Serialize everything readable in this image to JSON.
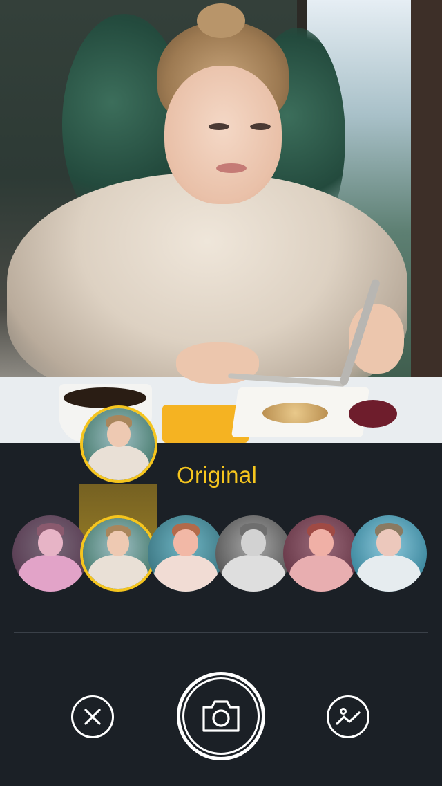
{
  "preview": {
    "description_icon": "photo-preview"
  },
  "filter": {
    "current_name": "Original",
    "accent_color": "#f5c51e",
    "thumbnails": [
      {
        "icon": "filter-thumb",
        "tint": "magenta"
      },
      {
        "icon": "filter-thumb",
        "tint": "original",
        "selected": true
      },
      {
        "icon": "filter-thumb",
        "tint": "warm"
      },
      {
        "icon": "filter-thumb",
        "tint": "mono"
      },
      {
        "icon": "filter-thumb",
        "tint": "red"
      },
      {
        "icon": "filter-thumb",
        "tint": "cool"
      }
    ]
  },
  "controls": {
    "close_icon": "close-icon",
    "shutter_icon": "camera-icon",
    "gallery_icon": "gallery-icon"
  },
  "colors": {
    "panel_background": "#1b2026",
    "accent": "#f5c51e",
    "button_outline": "#ffffff"
  }
}
